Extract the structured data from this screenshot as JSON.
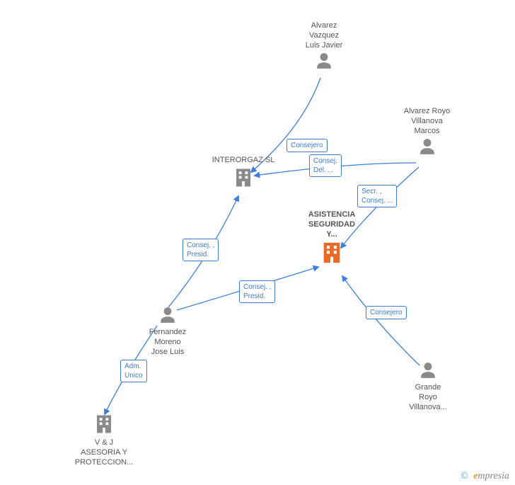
{
  "nodes": {
    "alvarez_vazquez": {
      "l1": "Alvarez",
      "l2": "Vazquez",
      "l3": "Luis Javier"
    },
    "alvarez_royo": {
      "l1": "Alvarez Royo",
      "l2": "Villanova",
      "l3": "Marcos"
    },
    "interorgaz": {
      "label": "INTERORGAZ SL"
    },
    "asistencia": {
      "l1": "ASISTENCIA",
      "l2": "SEGURIDAD",
      "l3": "Y..."
    },
    "fernandez": {
      "l1": "Fernandez",
      "l2": "Moreno",
      "l3": "Jose Luis"
    },
    "grande": {
      "l1": "Grande",
      "l2": "Royo",
      "l3": "Villanova..."
    },
    "vj": {
      "l1": "V & J",
      "l2": "ASESORIA Y",
      "l3": "PROTECCION..."
    }
  },
  "edges": {
    "e1": "Consejero",
    "e2": "Consej.\nDel. ...",
    "e3": "Secr. ,\nConsej. ...",
    "e4": "Consej. ,\nPresid.",
    "e5": "Consej. ,\nPresid.",
    "e6": "Adm.\nUnico",
    "e7": "Consejero"
  },
  "footer": {
    "copy": "©",
    "brand_e": "e",
    "brand_rest": "mpresia"
  }
}
